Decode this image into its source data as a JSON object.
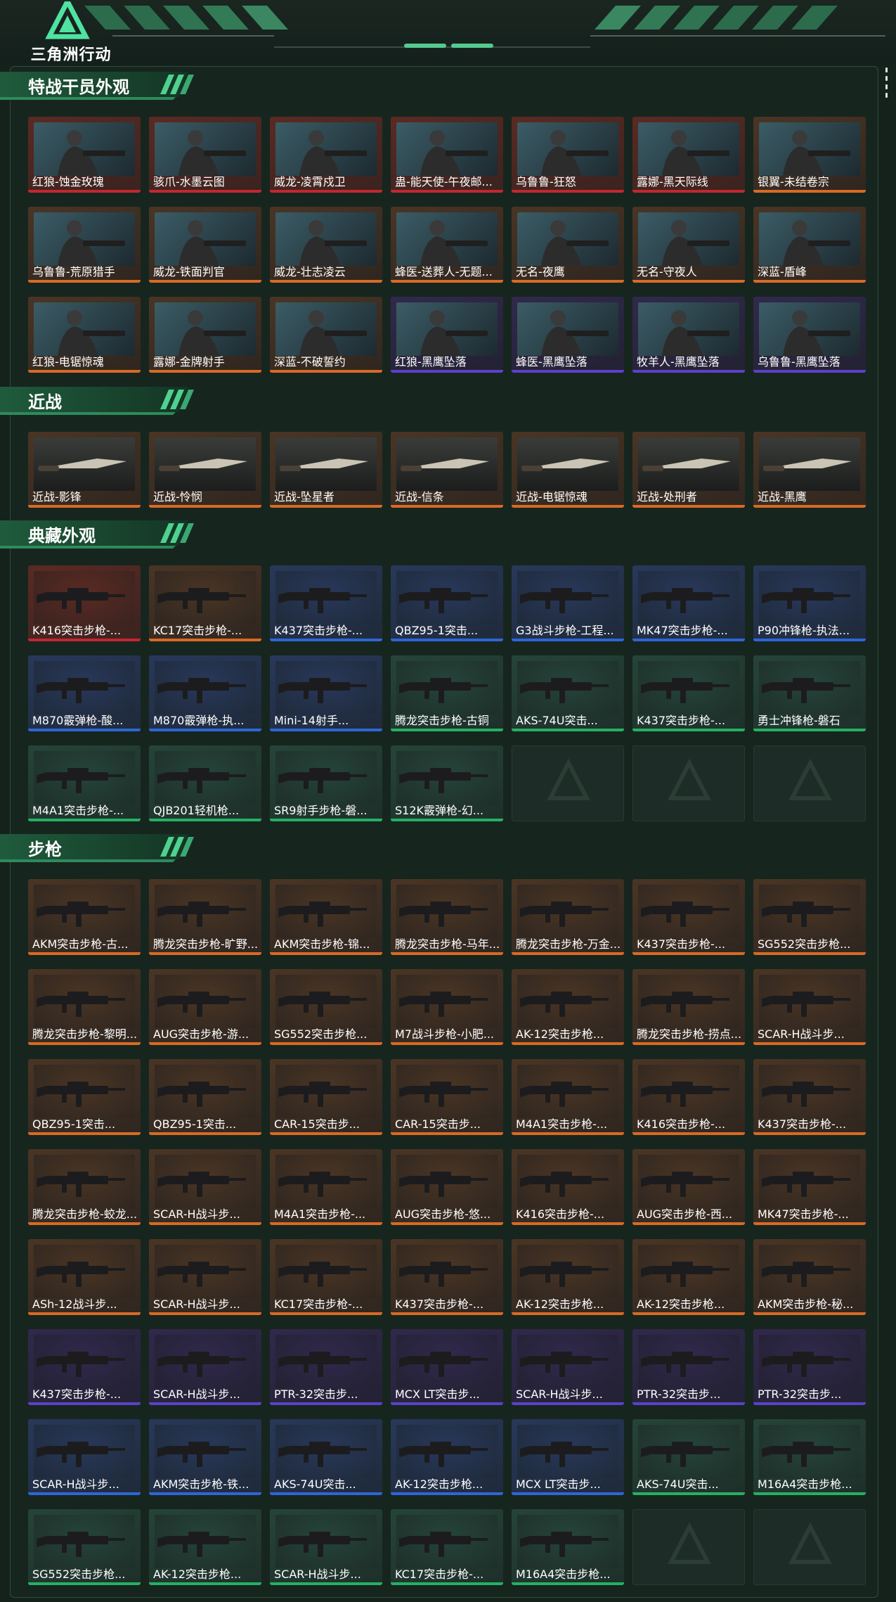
{
  "app": {
    "brand": "三角洲行动"
  },
  "colors": {
    "red": "#c4272f",
    "orange": "#d86a24",
    "purple": "#5a42c8",
    "blue": "#2d67d6",
    "green": "#25b063",
    "accent": "#55c98f"
  },
  "sections": [
    {
      "title": "特战干员外观",
      "items": [
        {
          "label": "红狼-蚀金玫瑰",
          "rarity": "red"
        },
        {
          "label": "骇爪-水墨云图",
          "rarity": "red"
        },
        {
          "label": "威龙-凌霄戍卫",
          "rarity": "red"
        },
        {
          "label": "蛊-能天使-午夜邮...",
          "rarity": "red"
        },
        {
          "label": "乌鲁鲁-狂怒",
          "rarity": "red"
        },
        {
          "label": "露娜-黑天际线",
          "rarity": "red"
        },
        {
          "label": "银翼-未结卷宗",
          "rarity": "orange"
        },
        {
          "label": "乌鲁鲁-荒原猎手",
          "rarity": "orange"
        },
        {
          "label": "威龙-铁面判官",
          "rarity": "orange"
        },
        {
          "label": "威龙-壮志凌云",
          "rarity": "orange"
        },
        {
          "label": "蜂医-送葬人-无题...",
          "rarity": "orange"
        },
        {
          "label": "无名-夜鹰",
          "rarity": "orange"
        },
        {
          "label": "无名-守夜人",
          "rarity": "orange"
        },
        {
          "label": "深蓝-盾峰",
          "rarity": "orange"
        },
        {
          "label": "红狼-电锯惊魂",
          "rarity": "orange"
        },
        {
          "label": "露娜-金牌射手",
          "rarity": "orange"
        },
        {
          "label": "深蓝-不破誓约",
          "rarity": "orange"
        },
        {
          "label": "红狼-黑鹰坠落",
          "rarity": "purple"
        },
        {
          "label": "蜂医-黑鹰坠落",
          "rarity": "purple"
        },
        {
          "label": "牧羊人-黑鹰坠落",
          "rarity": "purple"
        },
        {
          "label": "乌鲁鲁-黑鹰坠落",
          "rarity": "purple"
        }
      ]
    },
    {
      "title": "近战",
      "items": [
        {
          "label": "近战-影锋",
          "rarity": "orange"
        },
        {
          "label": "近战-怜悯",
          "rarity": "orange"
        },
        {
          "label": "近战-坠星者",
          "rarity": "orange"
        },
        {
          "label": "近战-信条",
          "rarity": "orange"
        },
        {
          "label": "近战-电锯惊魂",
          "rarity": "orange"
        },
        {
          "label": "近战-处刑者",
          "rarity": "orange"
        },
        {
          "label": "近战-黑鹰",
          "rarity": "orange"
        }
      ]
    },
    {
      "title": "典藏外观",
      "items": [
        {
          "label": "K416突击步枪-...",
          "rarity": "red"
        },
        {
          "label": "KC17突击步枪-...",
          "rarity": "orange"
        },
        {
          "label": "K437突击步枪-...",
          "rarity": "blue"
        },
        {
          "label": "QBZ95-1突击...",
          "rarity": "blue"
        },
        {
          "label": "G3战斗步枪-工程...",
          "rarity": "blue"
        },
        {
          "label": "MK47突击步枪-...",
          "rarity": "blue"
        },
        {
          "label": "P90冲锋枪-执法...",
          "rarity": "blue"
        },
        {
          "label": "M870霰弹枪-酸...",
          "rarity": "blue"
        },
        {
          "label": "M870霰弹枪-执...",
          "rarity": "blue"
        },
        {
          "label": "Mini-14射手...",
          "rarity": "blue"
        },
        {
          "label": "腾龙突击步枪-古铜",
          "rarity": "green"
        },
        {
          "label": "AKS-74U突击...",
          "rarity": "green"
        },
        {
          "label": "K437突击步枪-...",
          "rarity": "green"
        },
        {
          "label": "勇士冲锋枪-磐石",
          "rarity": "green"
        },
        {
          "label": "M4A1突击步枪-...",
          "rarity": "green"
        },
        {
          "label": "QJB201轻机枪...",
          "rarity": "green"
        },
        {
          "label": "SR9射手步枪-磐...",
          "rarity": "green"
        },
        {
          "label": "S12K霰弹枪-幻...",
          "rarity": "green"
        }
      ]
    },
    {
      "title": "步枪",
      "items": [
        {
          "label": "AKM突击步枪-古...",
          "rarity": "orange"
        },
        {
          "label": "腾龙突击步枪-旷野...",
          "rarity": "orange"
        },
        {
          "label": "AKM突击步枪-锦...",
          "rarity": "orange"
        },
        {
          "label": "腾龙突击步枪-马年...",
          "rarity": "orange"
        },
        {
          "label": "腾龙突击步枪-万金...",
          "rarity": "orange"
        },
        {
          "label": "K437突击步枪-...",
          "rarity": "orange"
        },
        {
          "label": "SG552突击步枪...",
          "rarity": "orange"
        },
        {
          "label": "腾龙突击步枪-黎明...",
          "rarity": "orange"
        },
        {
          "label": "AUG突击步枪-游...",
          "rarity": "orange"
        },
        {
          "label": "SG552突击步枪...",
          "rarity": "orange"
        },
        {
          "label": "M7战斗步枪-小肥...",
          "rarity": "orange"
        },
        {
          "label": "AK-12突击步枪...",
          "rarity": "orange"
        },
        {
          "label": "腾龙突击步枪-捞点...",
          "rarity": "orange"
        },
        {
          "label": "SCAR-H战斗步...",
          "rarity": "orange"
        },
        {
          "label": "QBZ95-1突击...",
          "rarity": "orange"
        },
        {
          "label": "QBZ95-1突击...",
          "rarity": "orange"
        },
        {
          "label": "CAR-15突击步...",
          "rarity": "orange"
        },
        {
          "label": "CAR-15突击步...",
          "rarity": "orange"
        },
        {
          "label": "M4A1突击步枪-...",
          "rarity": "orange"
        },
        {
          "label": "K416突击步枪-...",
          "rarity": "orange"
        },
        {
          "label": "K437突击步枪-...",
          "rarity": "orange"
        },
        {
          "label": "腾龙突击步枪-蛟龙...",
          "rarity": "orange"
        },
        {
          "label": "SCAR-H战斗步...",
          "rarity": "orange"
        },
        {
          "label": "M4A1突击步枪-...",
          "rarity": "orange"
        },
        {
          "label": "AUG突击步枪-悠...",
          "rarity": "orange"
        },
        {
          "label": "K416突击步枪-...",
          "rarity": "orange"
        },
        {
          "label": "AUG突击步枪-西...",
          "rarity": "orange"
        },
        {
          "label": "MK47突击步枪-...",
          "rarity": "orange"
        },
        {
          "label": "ASh-12战斗步...",
          "rarity": "orange"
        },
        {
          "label": "SCAR-H战斗步...",
          "rarity": "orange"
        },
        {
          "label": "KC17突击步枪-...",
          "rarity": "orange"
        },
        {
          "label": "K437突击步枪-...",
          "rarity": "orange"
        },
        {
          "label": "AK-12突击步枪...",
          "rarity": "orange"
        },
        {
          "label": "AK-12突击步枪...",
          "rarity": "orange"
        },
        {
          "label": "AKM突击步枪-秘...",
          "rarity": "orange"
        },
        {
          "label": "K437突击步枪-...",
          "rarity": "purple"
        },
        {
          "label": "SCAR-H战斗步...",
          "rarity": "purple"
        },
        {
          "label": "PTR-32突击步...",
          "rarity": "purple"
        },
        {
          "label": "MCX LT突击步...",
          "rarity": "purple"
        },
        {
          "label": "SCAR-H战斗步...",
          "rarity": "purple"
        },
        {
          "label": "PTR-32突击步...",
          "rarity": "purple"
        },
        {
          "label": "PTR-32突击步...",
          "rarity": "purple"
        },
        {
          "label": "SCAR-H战斗步...",
          "rarity": "blue"
        },
        {
          "label": "AKM突击步枪-铁...",
          "rarity": "blue"
        },
        {
          "label": "AKS-74U突击...",
          "rarity": "blue"
        },
        {
          "label": "AK-12突击步枪...",
          "rarity": "blue"
        },
        {
          "label": "MCX LT突击步...",
          "rarity": "blue"
        },
        {
          "label": "AKS-74U突击...",
          "rarity": "green"
        },
        {
          "label": "M16A4突击步枪...",
          "rarity": "green"
        },
        {
          "label": "SG552突击步枪...",
          "rarity": "green"
        },
        {
          "label": "AK-12突击步枪...",
          "rarity": "green"
        },
        {
          "label": "SCAR-H战斗步...",
          "rarity": "green"
        },
        {
          "label": "KC17突击步枪-...",
          "rarity": "green"
        },
        {
          "label": "M16A4突击步枪...",
          "rarity": "green"
        }
      ]
    }
  ]
}
